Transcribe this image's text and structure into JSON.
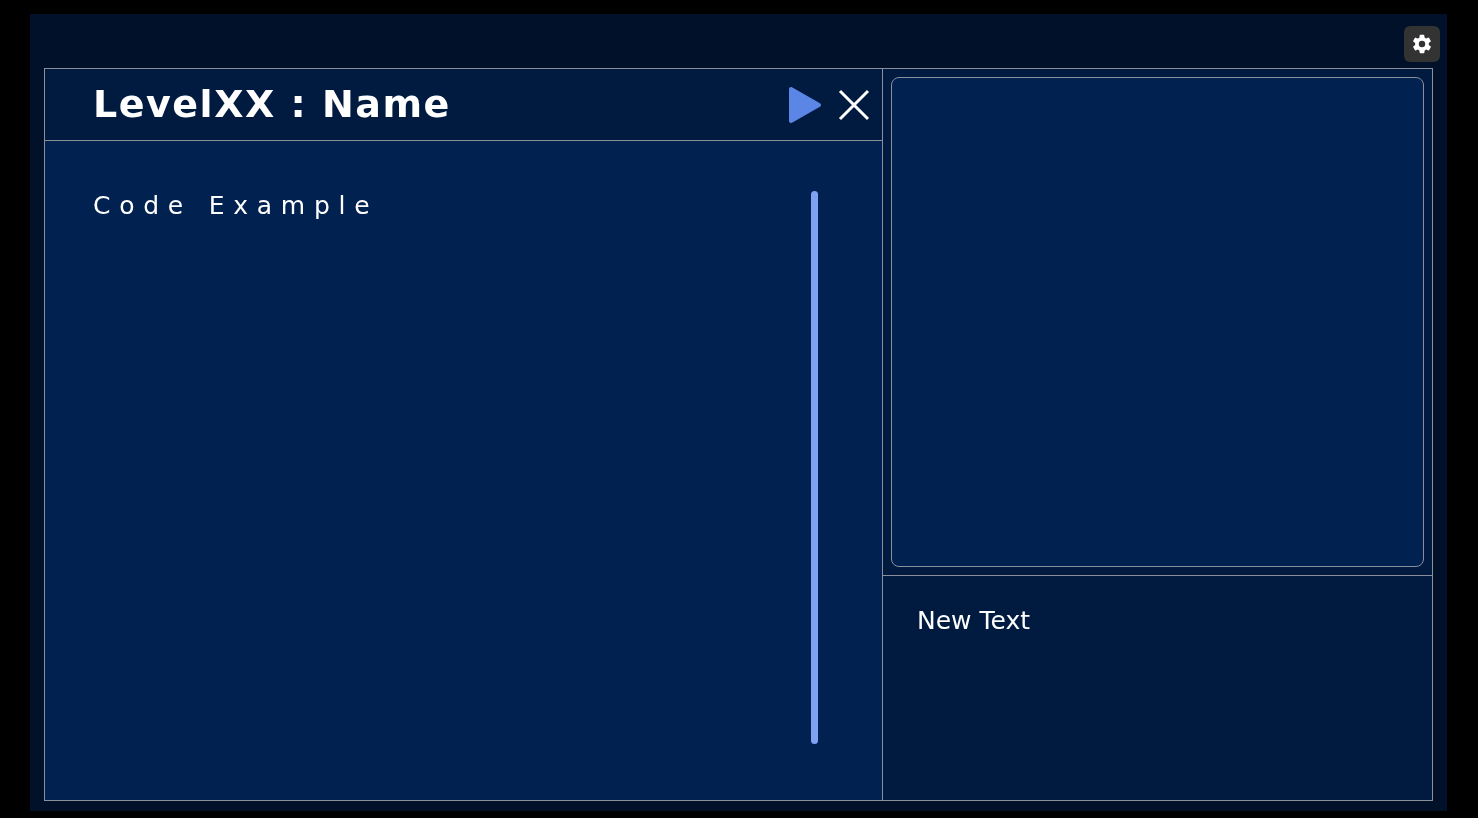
{
  "editor": {
    "title": "LevelXX : Name",
    "code": "Code Example"
  },
  "output": {
    "text": "New Text"
  }
}
